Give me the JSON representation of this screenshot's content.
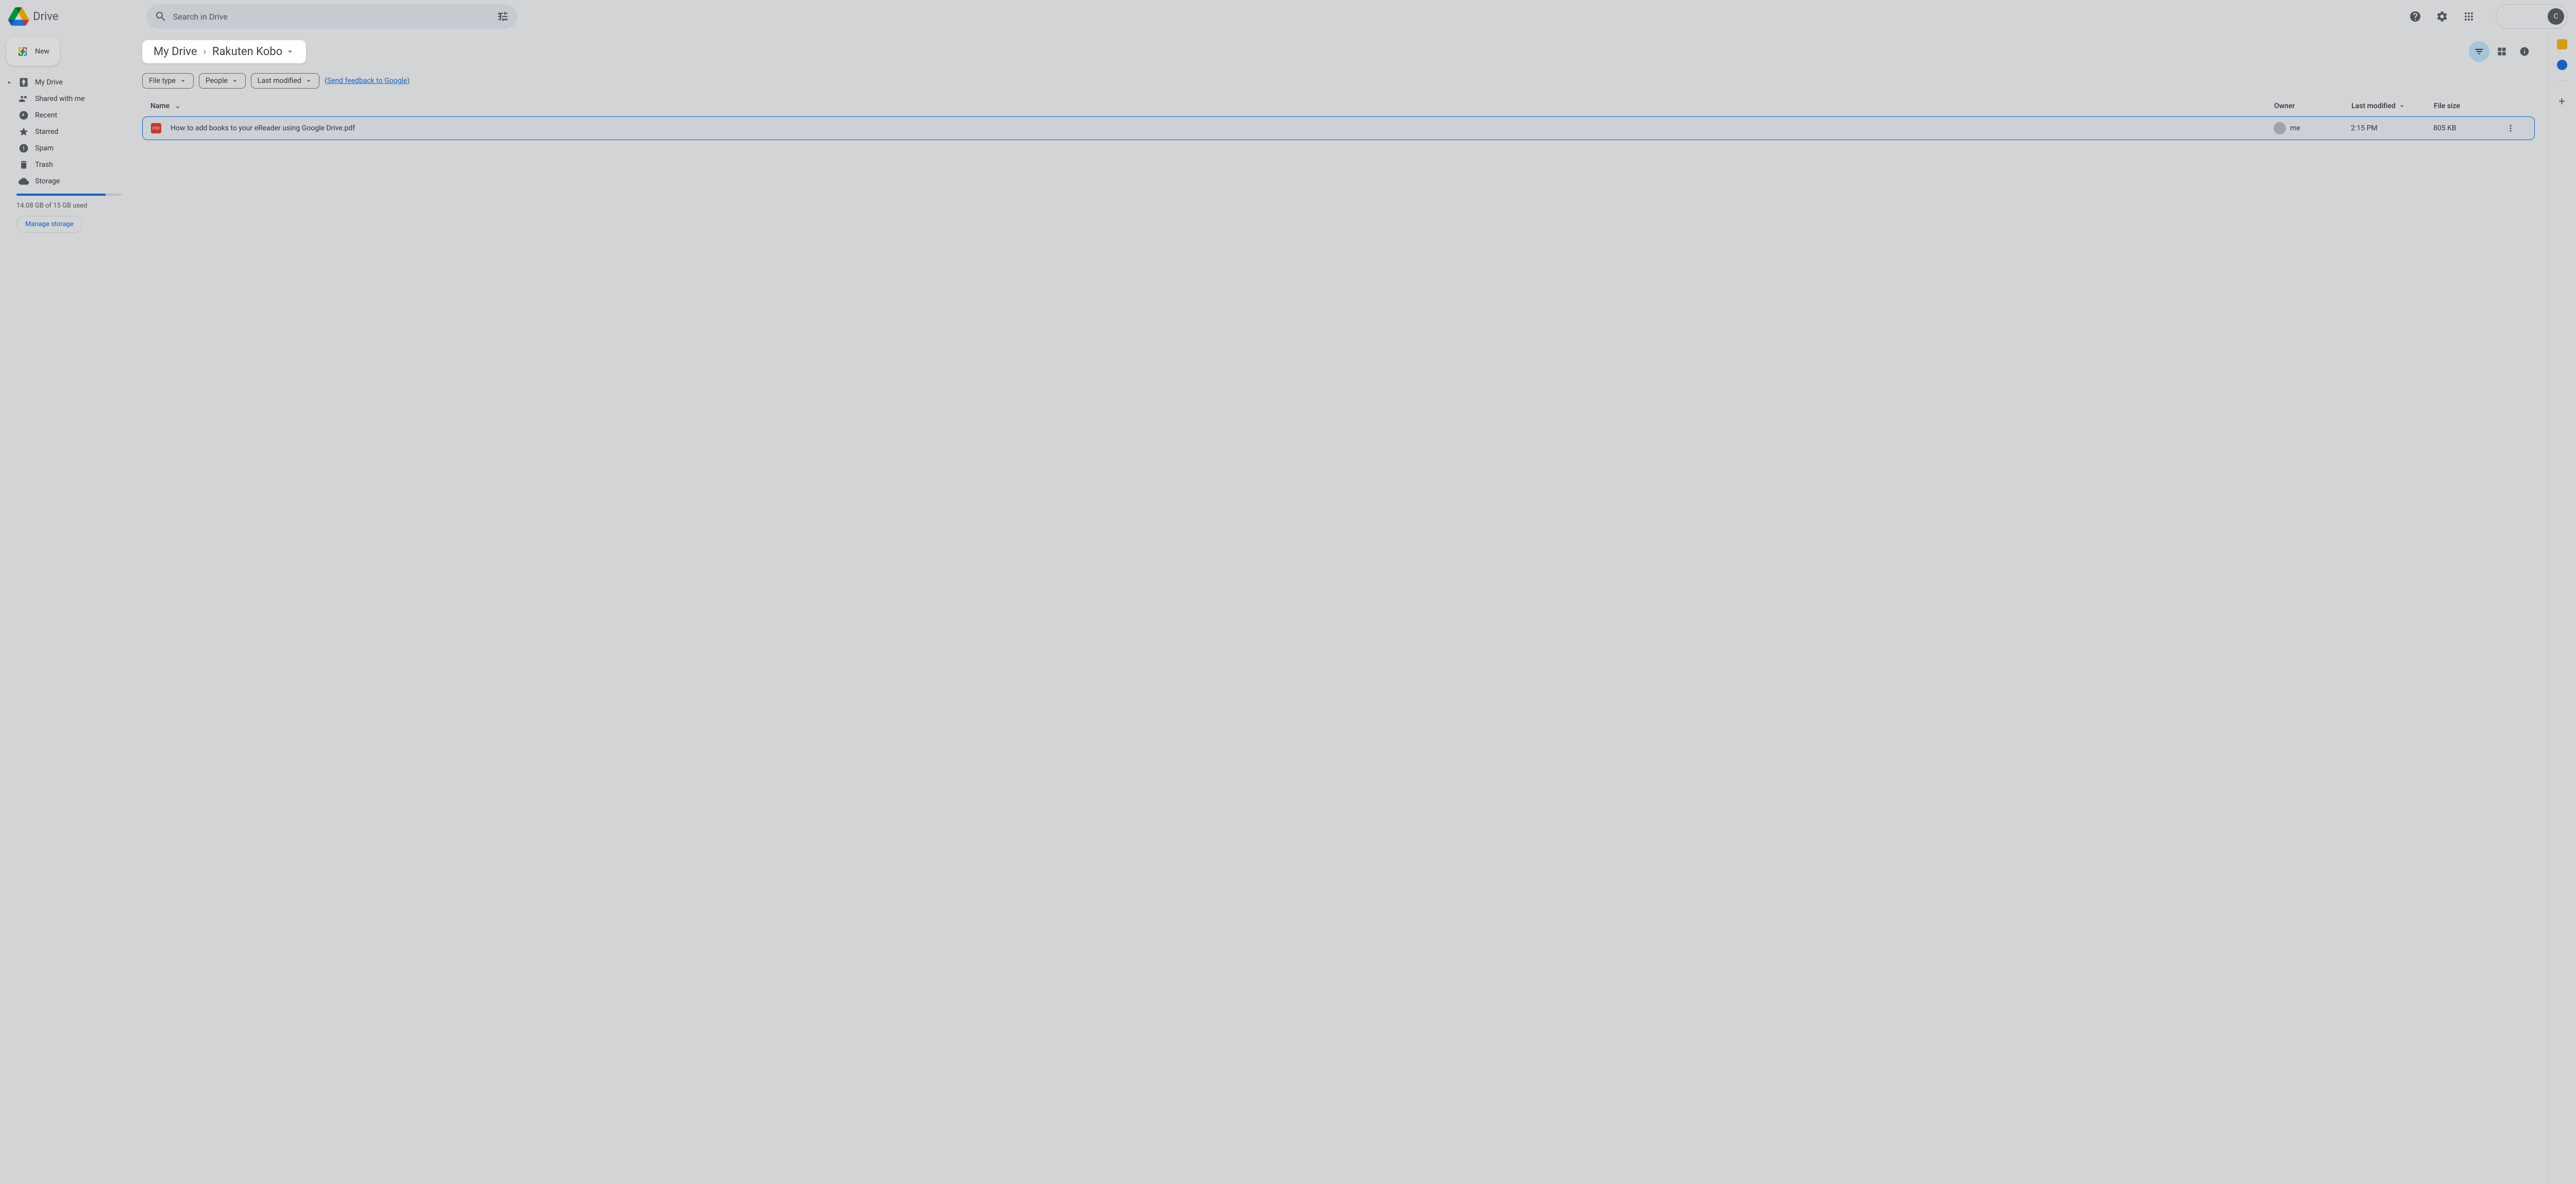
{
  "app": {
    "name": "Drive"
  },
  "search": {
    "placeholder": "Search in Drive"
  },
  "sidebar": {
    "new_label": "New",
    "items": [
      {
        "label": "My Drive"
      },
      {
        "label": "Shared with me"
      },
      {
        "label": "Recent"
      },
      {
        "label": "Starred"
      },
      {
        "label": "Spam"
      },
      {
        "label": "Trash"
      },
      {
        "label": "Storage"
      }
    ],
    "storage_text": "14.08 GB of 15 GB used",
    "storage_percent": 85,
    "manage_label": "Manage storage"
  },
  "breadcrumb": {
    "root": "My Drive",
    "current": "Rakuten Kobo"
  },
  "filters": {
    "type": "File type",
    "people": "People",
    "modified": "Last modified",
    "feedback_prefix": "(",
    "feedback_link": "Send feedback to Google",
    "feedback_suffix": ")"
  },
  "columns": {
    "name": "Name",
    "owner": "Owner",
    "modified": "Last modified",
    "size": "File size"
  },
  "files": [
    {
      "name": "How to add books to your eReader using Google Drive.pdf",
      "owner": "me",
      "modified": "2:15 PM",
      "size": "805 KB",
      "type": "PDF"
    }
  ],
  "account": {
    "initial": "C"
  }
}
